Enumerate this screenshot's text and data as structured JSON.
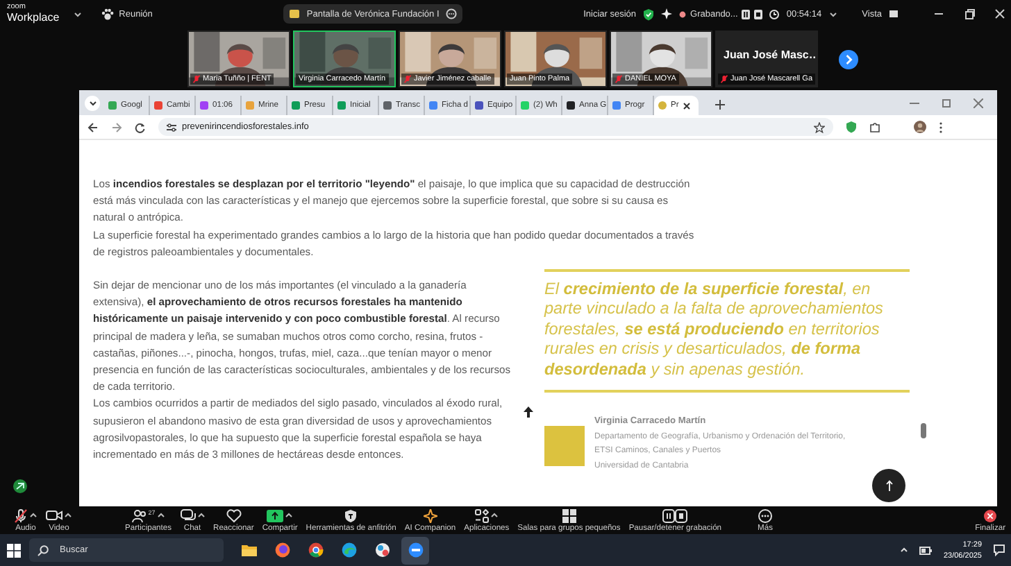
{
  "zoom_header": {
    "logo_top": "zoom",
    "logo_bottom": "Workplace",
    "meeting_menu": "Reunión",
    "shared_screen": "Pantalla de Verónica Fundación I",
    "sign_in": "Iniciar sesión",
    "recording_status": "Grabando...",
    "elapsed_time": "00:54:14",
    "view_menu": "Vista"
  },
  "participants": [
    {
      "kind": "video",
      "name": "Maria Tuñño | FENT",
      "muted": true,
      "speaking": false
    },
    {
      "kind": "video",
      "name": "Virginia Carracedo Martín",
      "muted": false,
      "speaking": true
    },
    {
      "kind": "video",
      "name": "Javier Jiménez caballe",
      "muted": true,
      "speaking": false
    },
    {
      "kind": "video",
      "name": "Juan Pinto Palma",
      "muted": false,
      "speaking": false
    },
    {
      "kind": "video",
      "name": "DANIEL MOYA",
      "muted": true,
      "speaking": false
    },
    {
      "kind": "name_card",
      "display_name": "Juan José Masc…",
      "name": "Juan José Mascarell Ga",
      "muted": true,
      "speaking": false
    }
  ],
  "browser": {
    "tabs": [
      {
        "title": "Googl",
        "color": "#34a853",
        "selected": false
      },
      {
        "title": "Cambi",
        "color": "#ea4335",
        "selected": false
      },
      {
        "title": "01:06",
        "color": "#a142f4",
        "selected": false
      },
      {
        "title": "Mrine",
        "color": "#e8a33d",
        "selected": false
      },
      {
        "title": "Presu",
        "color": "#0f9d58",
        "selected": false
      },
      {
        "title": "Inicial",
        "color": "#0f9d58",
        "selected": false
      },
      {
        "title": "Transc",
        "color": "#5f6368",
        "selected": false
      },
      {
        "title": "Ficha d",
        "color": "#4285f4",
        "selected": false
      },
      {
        "title": "Equipo",
        "color": "#4b53bc",
        "selected": false
      },
      {
        "title": "(2) Wh",
        "color": "#25d366",
        "selected": false
      },
      {
        "title": "Anna G",
        "color": "#202124",
        "selected": false
      },
      {
        "title": "Progr",
        "color": "#4285f4",
        "selected": false
      },
      {
        "title": "Pr",
        "color": "#d4b43c",
        "selected": true
      }
    ],
    "url": "prevenirincendiosforestales.info"
  },
  "article": {
    "intro": [
      "Los **incendios forestales se desplazan por el territorio \"leyendo\"** el paisaje, lo que implica que su capacidad de destrucción está más vinculada con las características y el manejo que ejercemos sobre la superficie forestal, que sobre si su causa es natural o antrópica.",
      "La superficie forestal ha experimentado grandes cambios a lo largo de la historia que han podido quedar documentados a través de registros paleoambientales y documentales."
    ],
    "body": [
      "Sin dejar de mencionar uno de los más importantes (el vinculado a la ganadería extensiva), **el aprovechamiento de otros recursos forestales ha mantenido históricamente un paisaje intervenido y con poco combustible forestal**. Al recurso principal de madera y leña, se sumaban muchos otros como corcho, resina, frutos -castañas, piñones...-, pinocha, hongos, trufas, miel, caza...que tenían mayor o menor presencia en función de las características socioculturales, ambientales y de los recursos de cada territorio.",
      "Los cambios ocurridos a partir de mediados del siglo pasado, vinculados al éxodo rural, supusieron el abandono masivo de esta gran diversidad de usos y aprovechamientos agrosilvopastorales, lo que ha supuesto que la superficie forestal española se haya incrementado en más de 3 millones de hectáreas desde entonces."
    ],
    "quote": "El **crecimiento de la superficie forestal**, en parte vinculado a la falta de aprovechamientos forestales, **se está produciendo** en territorios rurales en crisis y desarticulados, **de forma desordenada** y sin apenas gestión.",
    "author": {
      "name": "Virginia Carracedo Martín",
      "affiliation": [
        "Departamento de Geografía, Urbanismo y Ordenación del Territorio, ETSI Caminos, Canales y Puertos",
        "Universidad de Cantabria"
      ]
    }
  },
  "meeting_toolbar": {
    "items": [
      {
        "kind": "audio",
        "label": "Audio",
        "muted": true,
        "has_menu": true
      },
      {
        "kind": "video",
        "label": "Video",
        "muted": false,
        "has_menu": true
      },
      {
        "kind": "participants",
        "label": "Participantes",
        "count": "27",
        "has_menu": true
      },
      {
        "kind": "chat",
        "label": "Chat",
        "has_menu": true
      },
      {
        "kind": "react",
        "label": "Reaccionar",
        "has_menu": false
      },
      {
        "kind": "share",
        "label": "Compartir",
        "has_menu": true
      },
      {
        "kind": "host",
        "label": "Herramientas de anfitrión",
        "has_menu": false
      },
      {
        "kind": "ai",
        "label": "AI Companion",
        "has_menu": false
      },
      {
        "kind": "apps",
        "label": "Aplicaciones",
        "has_menu": true
      },
      {
        "kind": "rooms",
        "label": "Salas para grupos pequeños",
        "has_menu": false
      },
      {
        "kind": "record",
        "label": "Pausar/detener grabación",
        "has_menu": false
      },
      {
        "kind": "more",
        "label": "Más",
        "has_menu": false
      },
      {
        "kind": "end",
        "label": "Finalizar",
        "has_menu": false
      }
    ]
  },
  "taskbar": {
    "search_placeholder": "Buscar",
    "apps": [
      {
        "kind": "files",
        "selected": false
      },
      {
        "kind": "firefox",
        "selected": false
      },
      {
        "kind": "chrome",
        "selected": false
      },
      {
        "kind": "edge",
        "selected": false
      },
      {
        "kind": "photos",
        "selected": false
      },
      {
        "kind": "zoom",
        "selected": true
      }
    ],
    "time": "17:29",
    "date": "23/06/2025"
  }
}
